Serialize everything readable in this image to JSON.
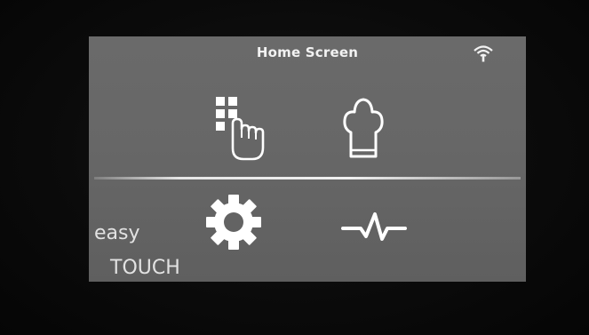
{
  "screen": {
    "title": "Home Screen"
  },
  "status_icons": [
    "wifi-icon"
  ],
  "menu": [
    {
      "name": "programs",
      "icon": "grid-touch-icon"
    },
    {
      "name": "chef",
      "icon": "chef-hat-icon"
    },
    {
      "name": "settings",
      "icon": "gear-icon"
    },
    {
      "name": "activity",
      "icon": "heartbeat-icon"
    }
  ],
  "brand": {
    "line1": "easy",
    "line2": "TOUCH"
  },
  "colors": {
    "screen_bg": "#666666",
    "icon": "#ffffff",
    "text": "#f2f2f2",
    "bezel": "#0a0a0a"
  }
}
